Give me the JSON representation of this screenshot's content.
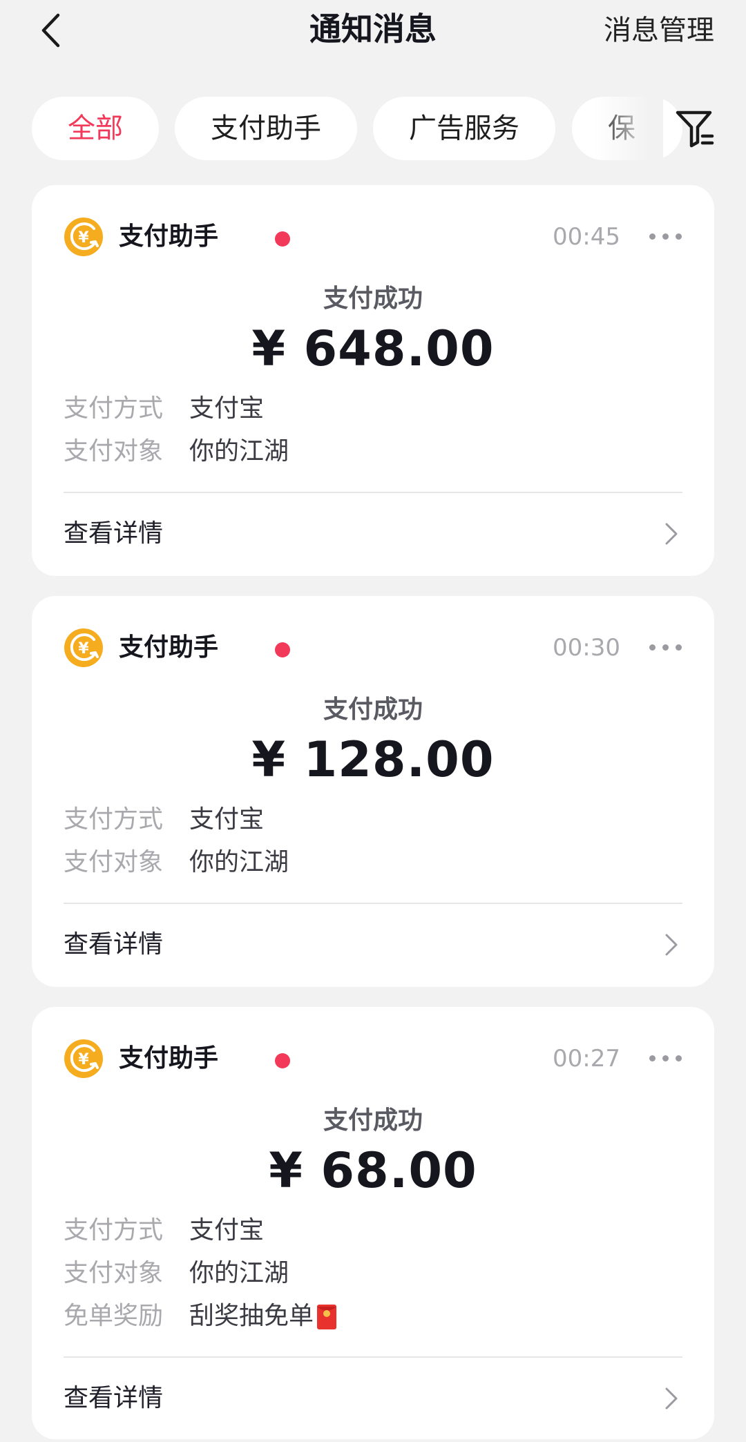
{
  "header": {
    "back_icon": "chevron-left-icon",
    "title": "通知消息",
    "manage_label": "消息管理"
  },
  "tabs": [
    {
      "label": "全部",
      "active": true
    },
    {
      "label": "支付助手",
      "active": false
    },
    {
      "label": "广告服务",
      "active": false
    },
    {
      "label": "保",
      "active": false
    }
  ],
  "filter_icon": "filter-icon",
  "colors": {
    "accent": "#f2395a",
    "coin": "#f5ac1e",
    "background": "#f2f2f2"
  },
  "labels": {
    "pay_method": "支付方式",
    "pay_target": "支付对象",
    "free_reward": "免单奖励",
    "view_details": "查看详情"
  },
  "messages": [
    {
      "sender": "支付助手",
      "time": "00:45",
      "status": "支付成功",
      "amount": "¥ 648.00",
      "pay_method": "支付宝",
      "pay_target": "你的江湖"
    },
    {
      "sender": "支付助手",
      "time": "00:30",
      "status": "支付成功",
      "amount": "¥ 128.00",
      "pay_method": "支付宝",
      "pay_target": "你的江湖"
    },
    {
      "sender": "支付助手",
      "time": "00:27",
      "status": "支付成功",
      "amount": "¥ 68.00",
      "pay_method": "支付宝",
      "pay_target": "你的江湖",
      "free_reward": "刮奖抽免单",
      "free_reward_icon": "red-packet-icon"
    }
  ]
}
